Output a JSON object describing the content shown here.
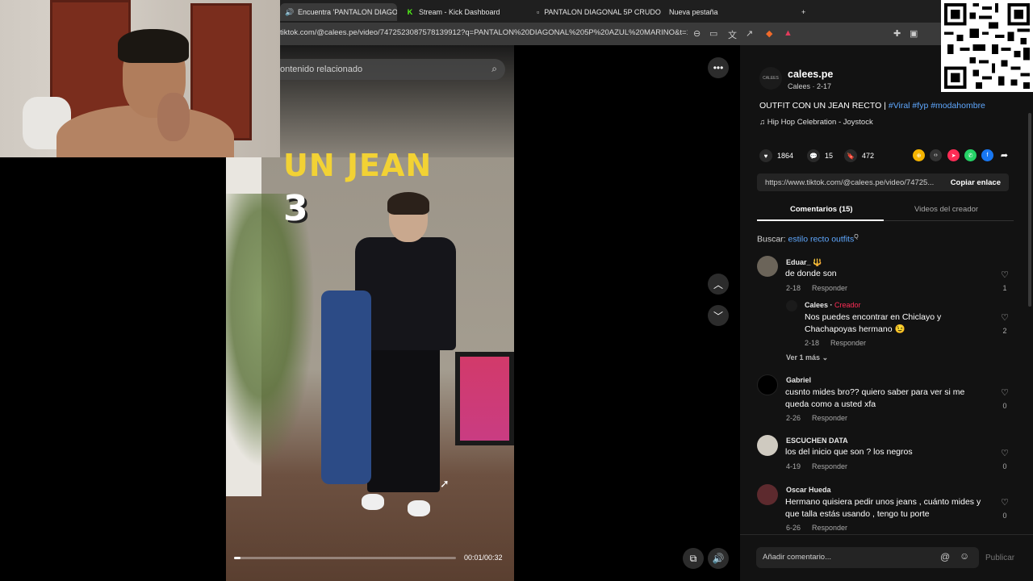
{
  "browser": {
    "tabs": [
      {
        "label": "Encuentra 'PANTALON DIAGO",
        "icon": "speaker-icon",
        "active": true
      },
      {
        "label": "Stream - Kick Dashboard",
        "icon": "kick-icon"
      },
      {
        "label": "PANTALON DIAGONAL 5P CRUDO",
        "icon": "page-icon"
      },
      {
        "label": "Nueva pestaña",
        "icon": ""
      }
    ],
    "new_tab": "+",
    "url": "tiktok.com/@calees.pe/video/7472523087578139912?q=PANTALON%20DIAGONAL%205P%20AZUL%20MARINO&t=17..."
  },
  "video": {
    "search_placeholder": "ontenido relacionado",
    "caption_line1": "UN JEAN",
    "caption_line2": "3",
    "time": "00:01/00:32",
    "progress": 0.03
  },
  "post": {
    "username": "calees.pe",
    "avatar_text": "CALEES",
    "display_name": "Calees",
    "date": "2-17",
    "description_prefix": "OUTFIT CON UN JEAN RECTO | ",
    "hashtags": "#Viral #fyp #modahombre",
    "music": "Hip Hop Celebration - Joystock",
    "likes": "1864",
    "comments": "15",
    "saves": "472",
    "link": "https://www.tiktok.com/@calees.pe/video/74725...",
    "copy_label": "Copiar enlace"
  },
  "tabs": {
    "comments": "Comentarios (15)",
    "creator_videos": "Videos del creador"
  },
  "search_suggest": {
    "label": "Buscar: ",
    "keyword": "estilo recto outfits",
    "sup": "Q"
  },
  "comments": [
    {
      "name": "Eduar_ 🔱",
      "text": "de donde son",
      "date": "2-18",
      "reply": "Responder",
      "likes": "1"
    },
    {
      "name": "Calees",
      "creator": "Creador",
      "text": "Nos puedes encontrar en Chiclayo y Chachapoyas hermano 😉",
      "date": "2-18",
      "reply": "Responder",
      "likes": "2"
    },
    {
      "name": "Gabriel",
      "text": "cusnto mides bro?? quiero saber para ver si me queda como a usted xfa",
      "date": "2-26",
      "reply": "Responder",
      "likes": "0"
    },
    {
      "name": "ESCUCHEN DATA",
      "text": "los del inicio que son ? los negros",
      "date": "4-19",
      "reply": "Responder",
      "likes": "0"
    },
    {
      "name": "Oscar Hueda",
      "text": "Hermano quisiera pedir unos jeans , cuánto mides y que talla estás usando , tengo tu porte",
      "date": "6-26",
      "reply": "Responder",
      "likes": "0"
    }
  ],
  "see_more": "Ver 1 más",
  "comment_input": {
    "placeholder": "Añadir comentario...",
    "publish": "Publicar"
  },
  "colors": {
    "accent_link": "#5fa8ff",
    "creator_red": "#fe2c55",
    "kick_green": "#53fc18",
    "panel_bg": "#121212"
  }
}
